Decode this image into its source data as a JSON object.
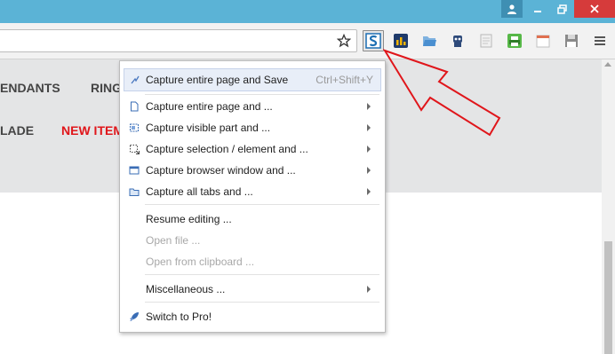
{
  "window_controls": {
    "user_icon": "person-icon",
    "minimize_icon": "minimize-icon",
    "maximize_icon": "maximize-icon",
    "close_icon": "close-icon"
  },
  "toolbar": {
    "address_value": "",
    "bookmark_icon": "star-icon",
    "extensions": [
      "screenshot-extension-icon",
      "chart-extension-icon",
      "folder-extension-icon",
      "robot-extension-icon",
      "blank-page-extension-icon",
      "printer-extension-icon",
      "calendar-extension-icon",
      "floppy-extension-icon",
      "menu-icon"
    ]
  },
  "page": {
    "nav_row1": [
      "ENDANTS",
      "RING"
    ],
    "nav_row2": [
      "LADE",
      "NEW ITEM"
    ],
    "new_item_color": "#e0161b"
  },
  "menu": {
    "items": [
      {
        "label": "Capture entire page and Save",
        "shortcut": "Ctrl+Shift+Y",
        "icon": "capture-save-icon"
      },
      {
        "label": "Capture entire page and ...",
        "icon": "page-icon"
      },
      {
        "label": "Capture visible part and ...",
        "icon": "visible-part-icon"
      },
      {
        "label": "Capture selection / element and ...",
        "icon": "selection-icon"
      },
      {
        "label": "Capture browser window and ...",
        "icon": "window-icon"
      },
      {
        "label": "Capture all tabs and ...",
        "icon": "tabs-icon"
      },
      {
        "label": "Resume editing ..."
      },
      {
        "label": "Open file ..."
      },
      {
        "label": "Open from clipboard ..."
      },
      {
        "label": "Miscellaneous ..."
      },
      {
        "label": "Switch to Pro!",
        "icon": "rocket-icon"
      }
    ]
  },
  "colors": {
    "titlebar": "#5bb3d6",
    "annotation_arrow": "#e0161b",
    "highlight": "#e8eef8"
  }
}
